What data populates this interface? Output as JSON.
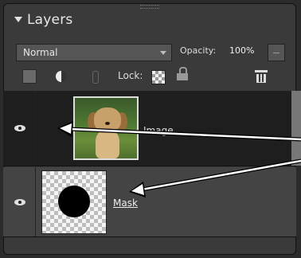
{
  "panel": {
    "title": "Layers"
  },
  "controls": {
    "blend_mode": "Normal",
    "opacity_label": "Opacity:",
    "opacity_value": "100%",
    "lock_label": "Lock:"
  },
  "layers": [
    {
      "name": "Image",
      "visible": true
    },
    {
      "name": "Mask",
      "visible": true
    }
  ],
  "icons": {
    "collapse": "triangle-down-icon",
    "new_layer": "new-layer-icon",
    "adjustment": "half-circle-icon",
    "link": "link-icon",
    "lock_transparent": "checker-lock-icon",
    "lock_all": "lock-icon",
    "delete": "trash-icon",
    "visibility": "eye-icon"
  },
  "colors": {
    "panel_bg": "#3a3a3a",
    "selected_row_bg": "#1e1e1e",
    "text": "#e8e8e8",
    "annotation_arrow": "#ffffff"
  }
}
